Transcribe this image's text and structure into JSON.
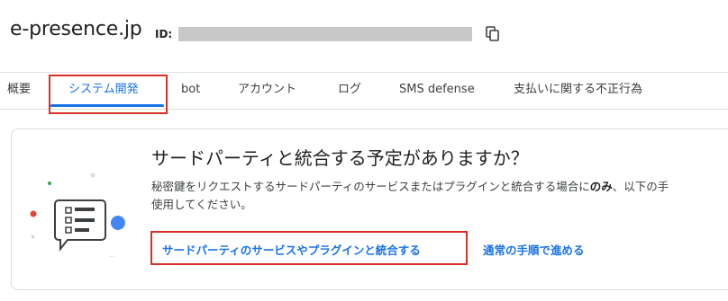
{
  "header": {
    "site_name": "e-presence.jp",
    "id_label": "ID:",
    "copy_icon": "copy-icon"
  },
  "tabs": [
    {
      "label": "概要",
      "active": false
    },
    {
      "label": "システム開発",
      "active": true
    },
    {
      "label": "bot",
      "active": false
    },
    {
      "label": "アカウント",
      "active": false
    },
    {
      "label": "ログ",
      "active": false
    },
    {
      "label": "SMS defense",
      "active": false
    },
    {
      "label": "支払いに関する不正行為",
      "active": false
    }
  ],
  "card": {
    "title": "サードパーティと統合する予定がありますか？",
    "description_line1_before": "秘密鍵をリクエストするサードパーティのサービスまたはプラグインと統合する場合に",
    "description_line1_bold": "のみ",
    "description_line1_after": "、以下の手",
    "description_line2": "使用してください。",
    "primary_link": "サードパーティのサービスやプラグインと統合する",
    "secondary_link": "通常の手順で進める",
    "illustration_icon": "chat-form-illustration-icon"
  },
  "colors": {
    "accent": "#1a73e8",
    "highlight": "#d93025",
    "border": "#dadce0"
  }
}
